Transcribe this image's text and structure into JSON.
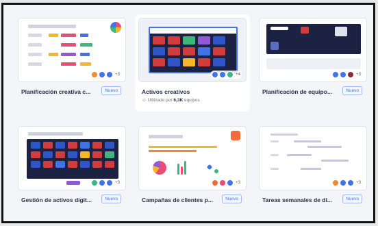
{
  "templates": [
    {
      "title": "Planificación creativa c...",
      "badge": "Nuevo",
      "avatar_more": "+3",
      "highlight": false
    },
    {
      "title": "Activos creativos",
      "badge": "",
      "avatar_more": "+4",
      "usage_prefix": "Utilizado por",
      "usage_count": "6,3K",
      "usage_suffix": "equipos",
      "highlight": true
    },
    {
      "title": "Planificación de equipo...",
      "badge": "Nuevo",
      "avatar_more": "+3",
      "highlight": false
    },
    {
      "title": "Gestión de activos digit...",
      "badge": "Nuevo",
      "avatar_more": "+3",
      "highlight": false
    },
    {
      "title": "Campañas de clientes p...",
      "badge": "Nuevo",
      "avatar_more": "+3",
      "highlight": false
    },
    {
      "title": "Tareas semanales de di...",
      "badge": "Nuevo",
      "avatar_more": "+3",
      "highlight": false
    }
  ],
  "colors": {
    "accent": "#3f74e8",
    "dark_board": "#1c2242",
    "red_tile": "#d13c3c",
    "blue_tile": "#2f55c9",
    "orange": "#f28b30",
    "green": "#3fb67e",
    "purple": "#8e5ad8"
  }
}
